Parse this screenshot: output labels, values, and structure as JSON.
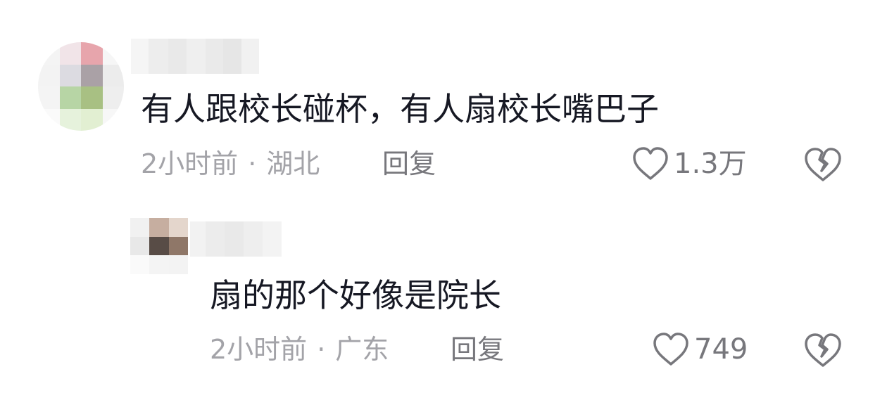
{
  "comments": [
    {
      "text": "有人跟校长碰杯，有人扇校长嘴巴子",
      "time": "2小时前",
      "separator": "·",
      "location": "湖北",
      "reply_label": "回复",
      "like_count": "1.3万",
      "like_icon": "heart-outline-icon",
      "dislike_icon": "broken-heart-icon"
    },
    {
      "text": "扇的那个好像是院长",
      "time": "2小时前",
      "separator": "·",
      "location": "广东",
      "reply_label": "回复",
      "like_count": "749",
      "like_icon": "heart-outline-icon",
      "dislike_icon": "broken-heart-icon"
    }
  ]
}
